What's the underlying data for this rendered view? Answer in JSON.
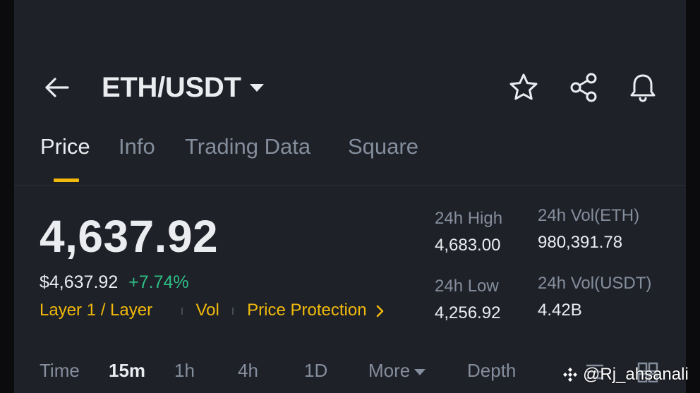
{
  "header": {
    "pair": "ETH/USDT",
    "icons": [
      "back-arrow-icon",
      "caret-down-icon",
      "star-icon",
      "share-icon",
      "bell-icon"
    ]
  },
  "tabs": [
    {
      "label": "Price",
      "active": true
    },
    {
      "label": "Info",
      "active": false
    },
    {
      "label": "Trading Data",
      "active": false
    },
    {
      "label": "Square",
      "active": false
    }
  ],
  "price": {
    "last": "4,637.92",
    "usd": "$4,637.92",
    "change": "+7.74%"
  },
  "tags": {
    "category": "Layer 1 / Layer",
    "vol": "Vol",
    "protection": "Price Protection"
  },
  "stats": {
    "high_label": "24h High",
    "high_value": "4,683.00",
    "low_label": "24h Low",
    "low_value": "4,256.92",
    "vol_eth_label": "24h Vol(ETH)",
    "vol_eth_value": "980,391.78",
    "vol_usdt_label": "24h Vol(USDT)",
    "vol_usdt_value": "4.42B"
  },
  "intervals": {
    "time": "Time",
    "m15": "15m",
    "h1": "1h",
    "h4": "4h",
    "d1": "1D",
    "more": "More",
    "depth": "Depth",
    "active": "15m"
  },
  "watermark": "@Rj_ahsanali",
  "colors": {
    "background": "#1f2129",
    "accent": "#f0b90b",
    "positive": "#2ebd85",
    "text_primary": "#eaecef",
    "text_secondary": "#848e9c"
  }
}
